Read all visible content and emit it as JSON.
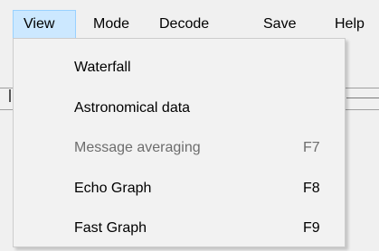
{
  "menubar": {
    "items": [
      {
        "label": "View",
        "active": true
      },
      {
        "label": "Mode"
      },
      {
        "label": "Decode"
      },
      {
        "label": "Save"
      },
      {
        "label": "Help"
      }
    ]
  },
  "view_menu": {
    "items": [
      {
        "label": "Waterfall",
        "shortcut": "",
        "enabled": true
      },
      {
        "label": "Astronomical data",
        "shortcut": "",
        "enabled": true
      },
      {
        "label": "Message averaging",
        "shortcut": "F7",
        "enabled": false
      },
      {
        "label": "Echo Graph",
        "shortcut": "F8",
        "enabled": true
      },
      {
        "label": "Fast Graph",
        "shortcut": "F9",
        "enabled": true
      }
    ]
  },
  "colors": {
    "menubar_bg": "#f0f0f0",
    "active_highlight": "#cce8ff",
    "active_border": "#99d1ff",
    "menu_bg": "#f2f2f2",
    "disabled_text": "#6d6d6d"
  }
}
